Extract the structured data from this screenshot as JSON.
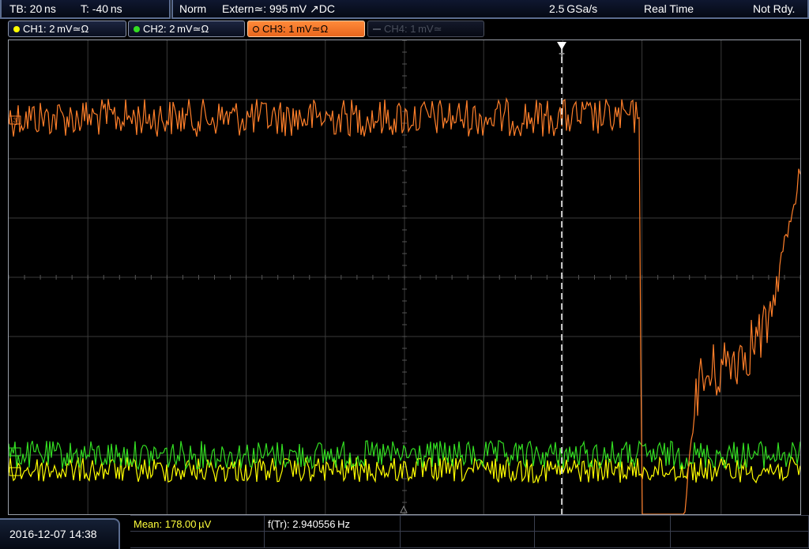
{
  "header": {
    "timebase": "TB: 20 ns",
    "trigger_pos": "T: -40 ns",
    "trigger_mode": "Norm",
    "trigger_source": "Extern≃: 995 mV ↗DC",
    "sample_rate": "2.5 GSa/s",
    "acq_mode": "Real Time",
    "status": "Not Rdy."
  },
  "channels": [
    {
      "label": "CH1: 2 mV≃Ω",
      "color": "#ffff00",
      "state": "on"
    },
    {
      "label": "CH2: 2 mV≃Ω",
      "color": "#33dd22",
      "state": "on"
    },
    {
      "label": "CH3: 1 mV≃Ω",
      "color": "#ff7f2a",
      "state": "active"
    },
    {
      "label": "CH4: 1 mV≃",
      "color": "#4a4f5c",
      "state": "off"
    }
  ],
  "waveform_markers": {
    "ch3_marker": "3",
    "trigger_marker": "T"
  },
  "measurements": {
    "mean": "Mean: 178.00 µV",
    "frequency": "f(Tr): 2.940556 Hz"
  },
  "datetime": "2016-12-07 14:38",
  "colors": {
    "ch1": "#ffff00",
    "ch2": "#33dd22",
    "ch3": "#ff7f2a",
    "grid": "#3a3a3a",
    "trigger_line": "#ffffff"
  }
}
